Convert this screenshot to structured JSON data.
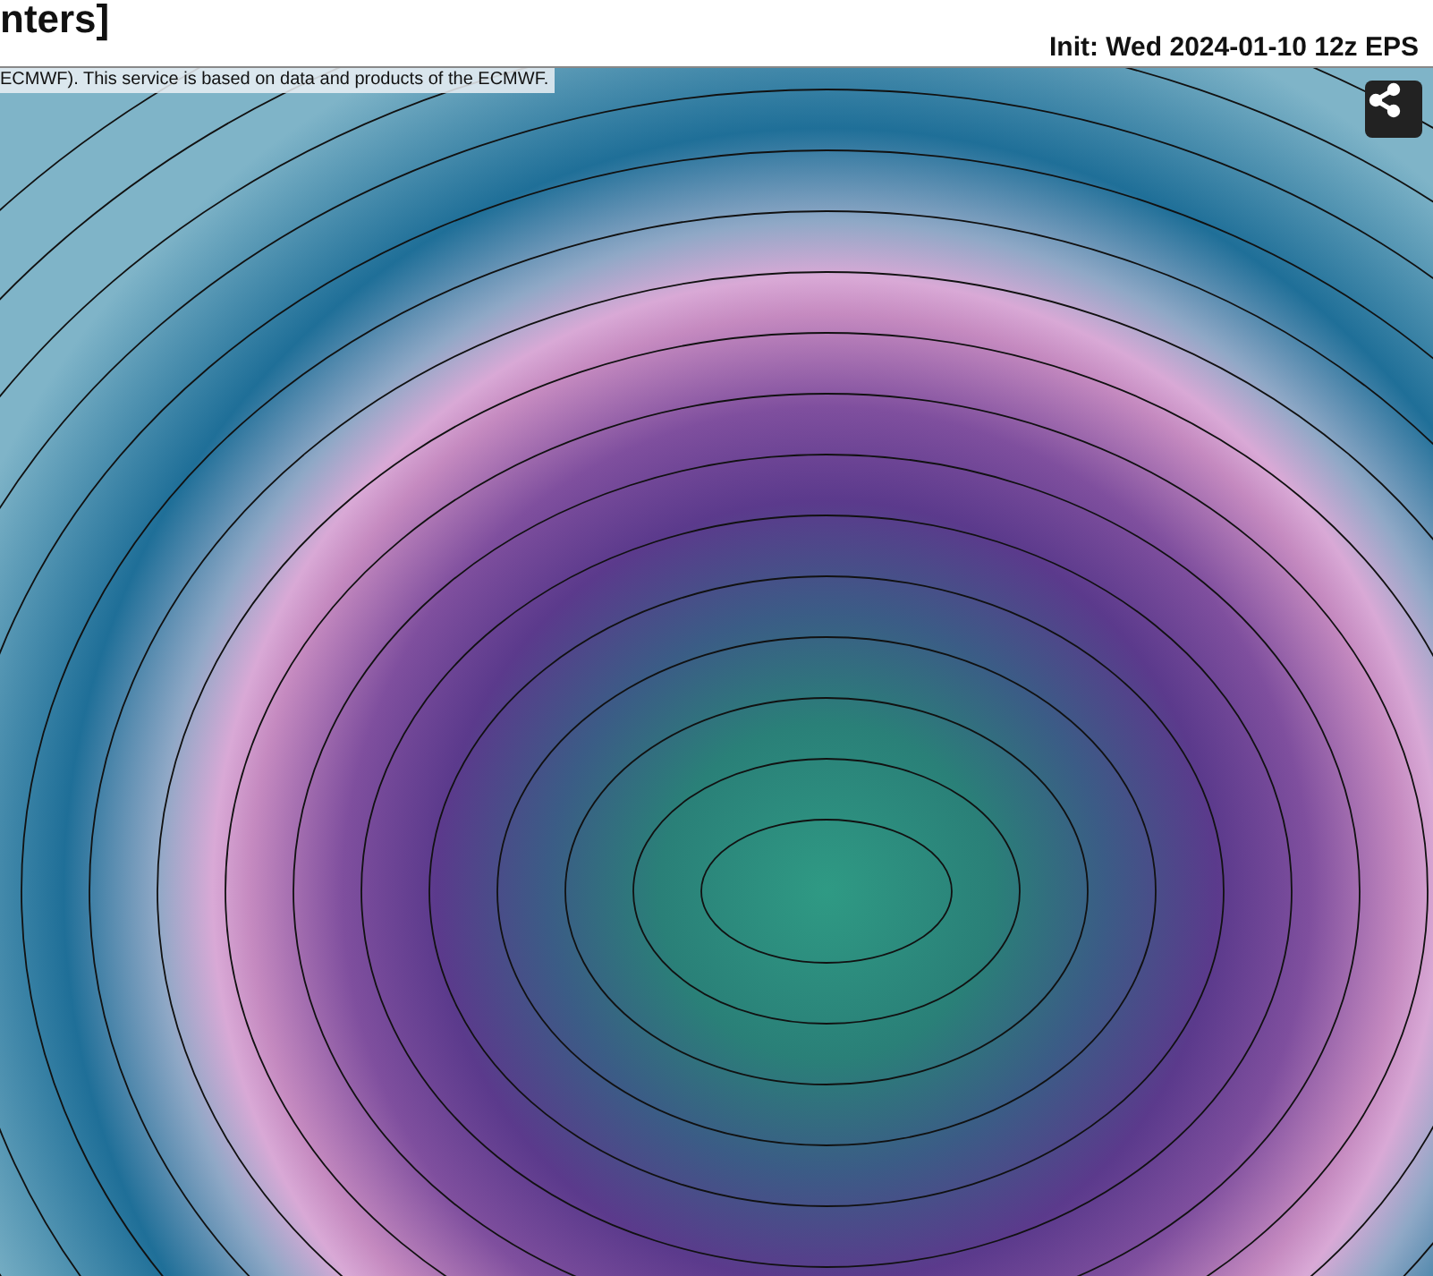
{
  "header": {
    "title": "nters]",
    "init": "Init: Wed 2024-01-10 12z EPS"
  },
  "map": {
    "attribution": "ECMWF). This service is based on data and products of the ECMWF."
  }
}
